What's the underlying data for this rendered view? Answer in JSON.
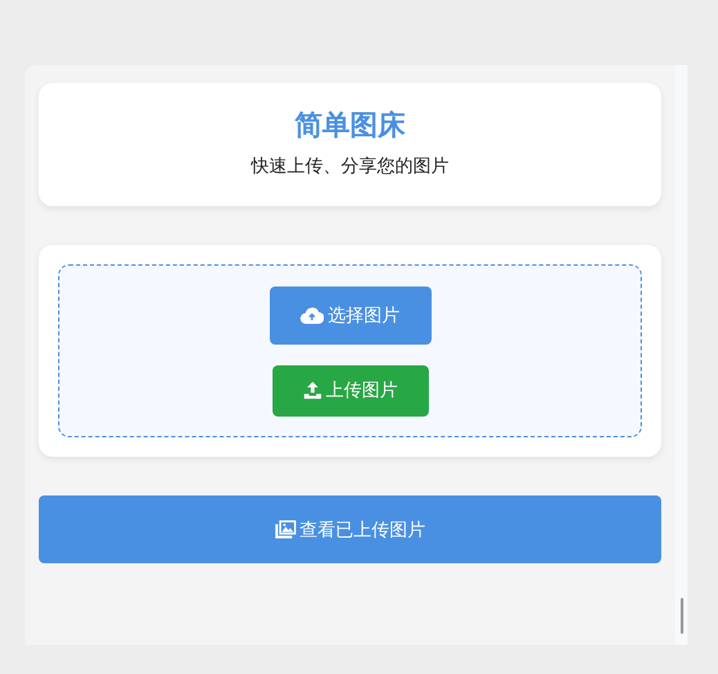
{
  "header": {
    "title": "简单图床",
    "subtitle": "快速上传、分享您的图片"
  },
  "upload_zone": {
    "buttons": [
      {
        "kind": "select",
        "label": "选择图片"
      },
      {
        "kind": "upload",
        "label": "上传图片"
      }
    ]
  },
  "view_button": {
    "label": "查看已上传图片"
  }
}
